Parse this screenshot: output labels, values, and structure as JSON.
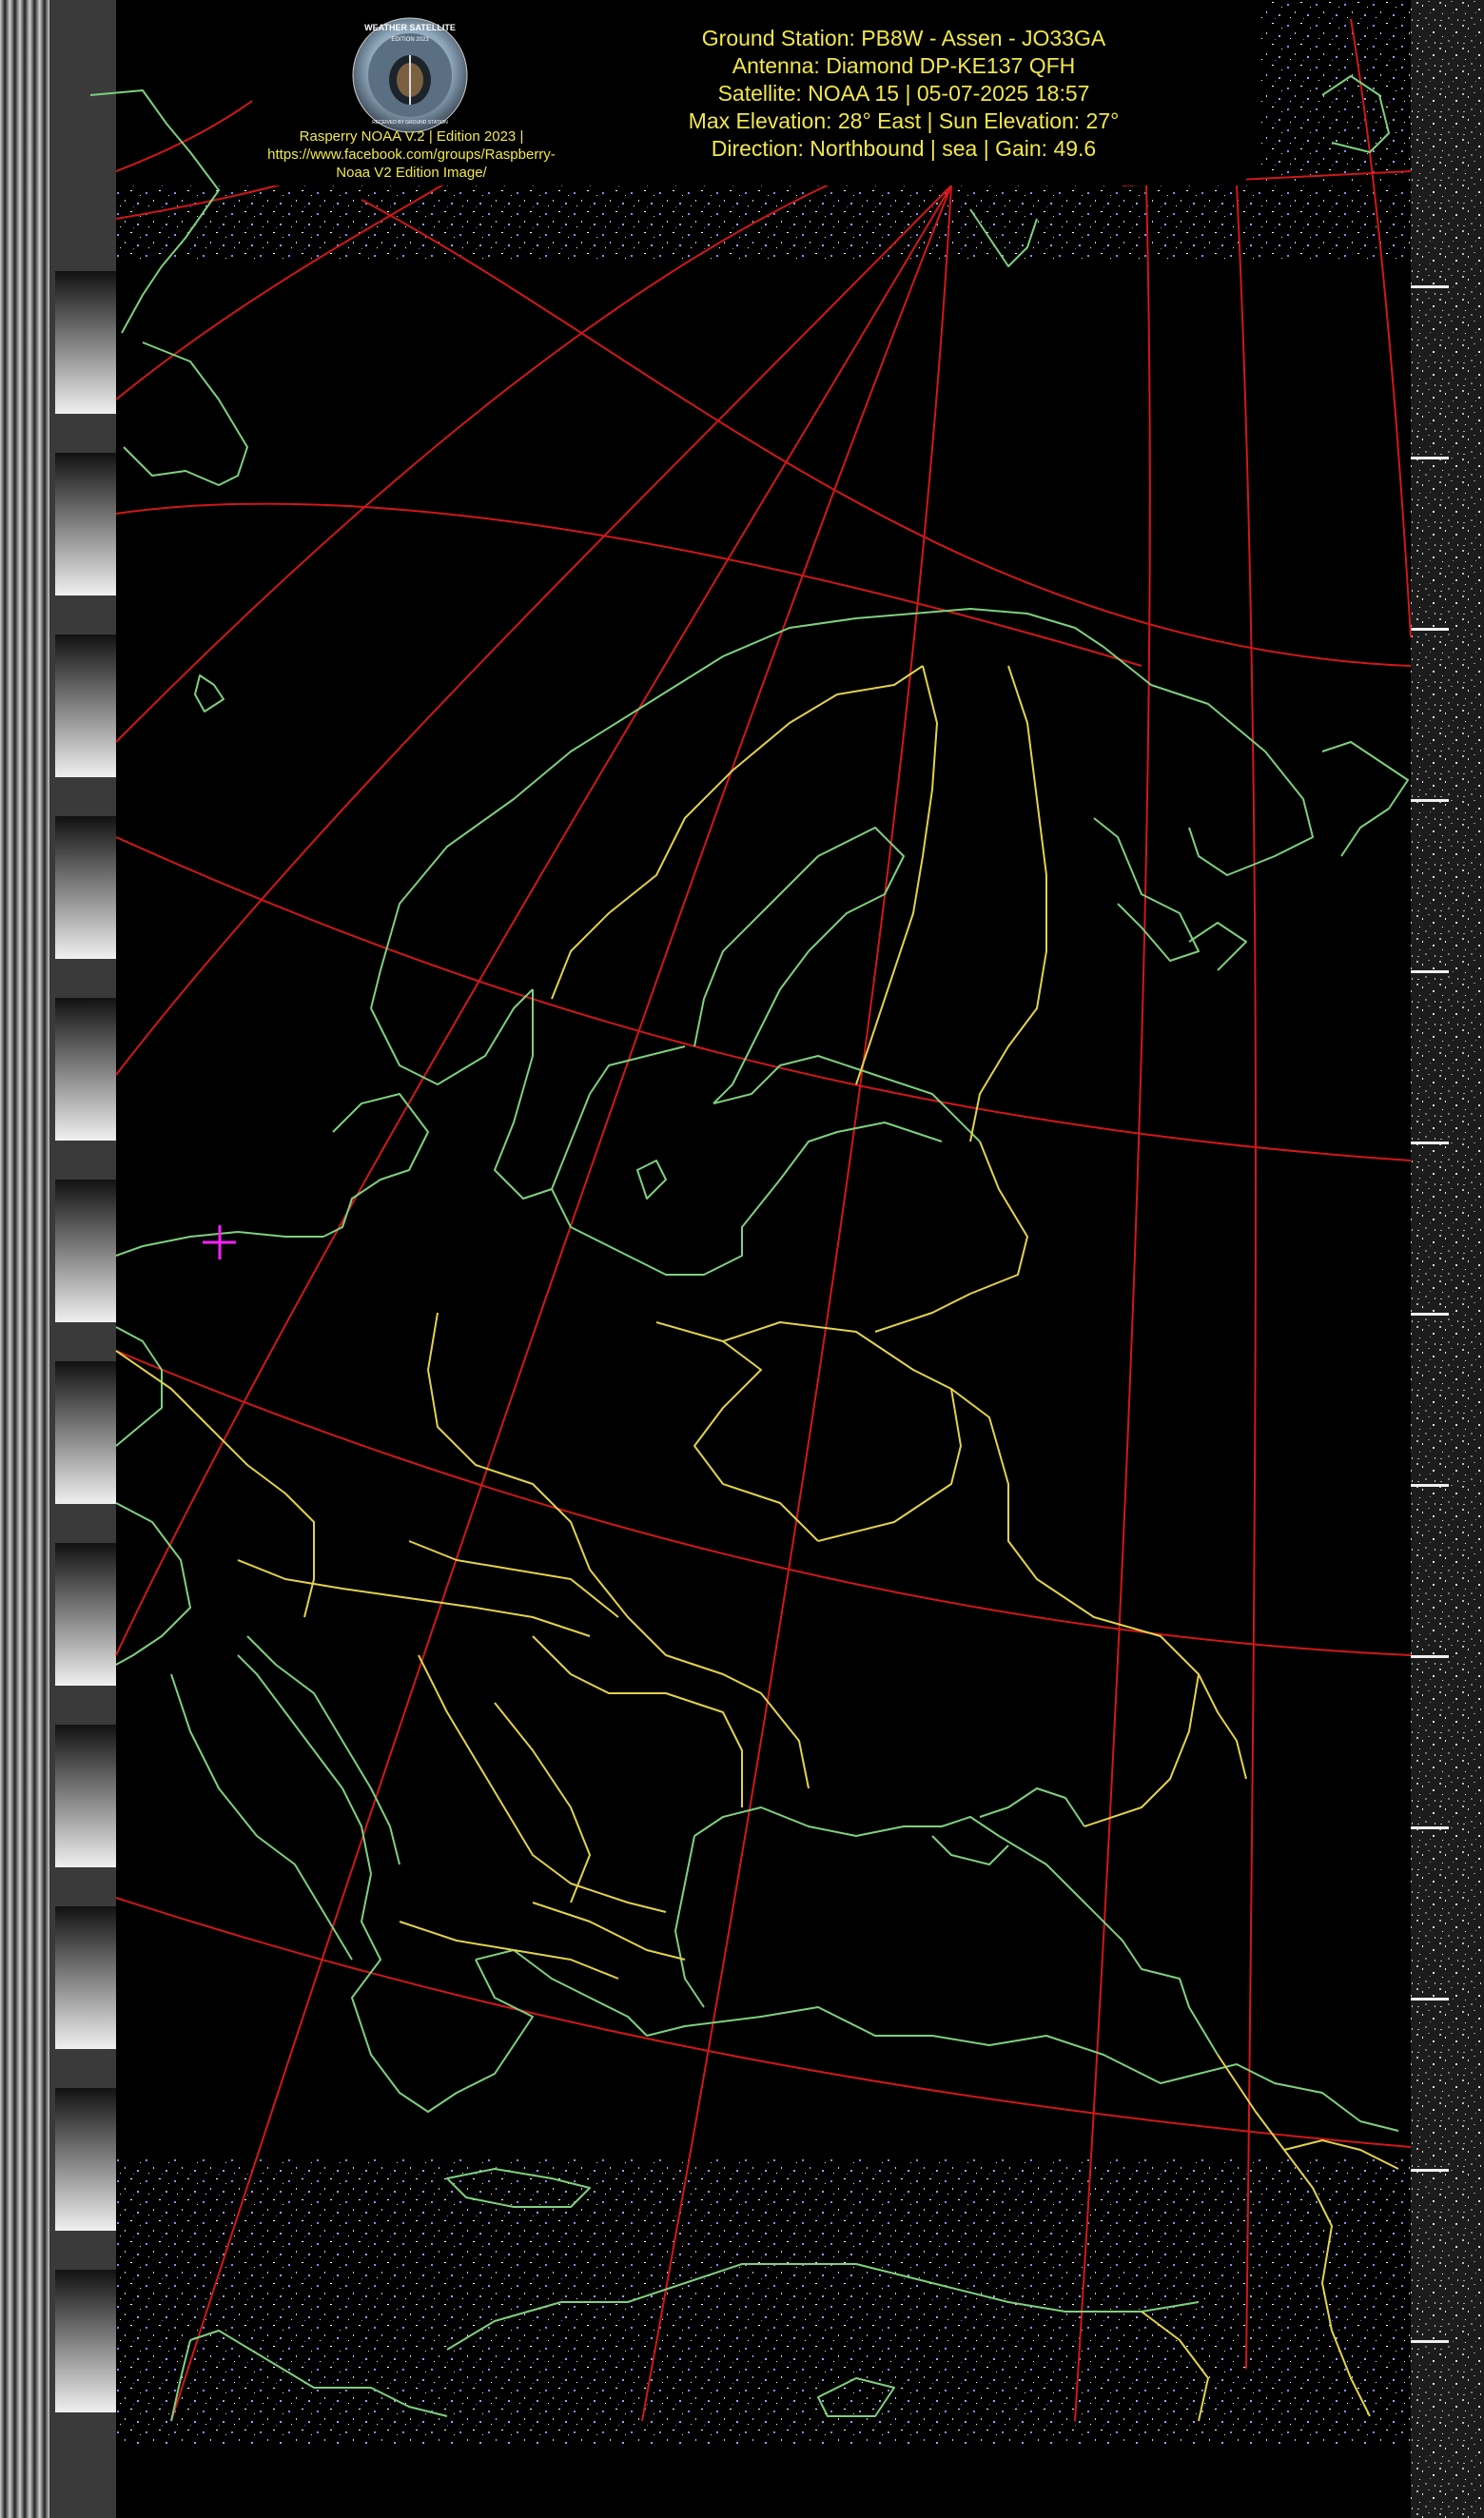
{
  "header": {
    "lines": [
      "Ground Station: PB8W - Assen - JO33GA",
      "Antenna: Diamond DP-KE137 QFH",
      "Satellite: NOAA 15 | 05-07-2025 18:57",
      "Max Elevation: 28° East | Sun Elevation: 27°",
      "Direction: Northbound | sea | Gain: 49.6"
    ]
  },
  "credit": {
    "lines": [
      "Rasperry NOAA V.2 | Edition 2023 |",
      "https://www.facebook.com/groups/Raspberry-",
      "Noaa V2 Edition Image/"
    ]
  },
  "logo": {
    "top_text": "WEATHER SATELLITE",
    "sub_text": "EDITION 2023",
    "bottom_text": "RECEIVED BY GROUND STATION",
    "icon": "satellite-dish-logo"
  },
  "map": {
    "ground_station_marker": "crosshair-icon",
    "colors": {
      "background": "#000000",
      "coastline": "#7ed07e",
      "borders": "#e2d24a",
      "graticule": "#d01818",
      "marker": "#ff20ff",
      "header_text": "#f2e84a"
    }
  }
}
